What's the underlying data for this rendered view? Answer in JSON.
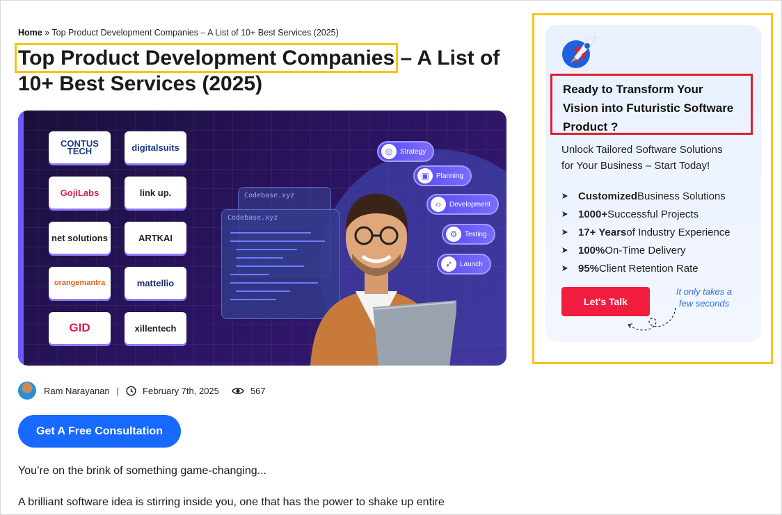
{
  "breadcrumb": {
    "home": "Home",
    "separator": "»",
    "current": "Top Product Development Companies – A List of 10+ Best Services (2025)"
  },
  "article": {
    "title_highlight": "Top Product Development Companies",
    "title_rest": " – A List of 10+ Best Services (2025)",
    "author": "Ram Narayanan",
    "date": "February 7th, 2025",
    "views": "567",
    "cta_label": "Get A Free Consultation",
    "paragraphs": [
      "You’re on the brink of something game-changing...",
      "A brilliant software idea is stirring inside you, one that has the power to shake up entire"
    ]
  },
  "hero": {
    "logos": [
      "CONTUS TECH",
      "digitalsuits",
      "GojiLabs",
      "link up.",
      "net solutions",
      "ARTKAI",
      "orangemantra",
      "mattellio",
      "GID",
      "xillentech"
    ],
    "code_windows": [
      "Codebase.xyz",
      "Codebase.xyz"
    ],
    "stages": [
      {
        "label": "Strategy",
        "icon": "target-icon"
      },
      {
        "label": "Planning",
        "icon": "presentation-icon"
      },
      {
        "label": "Development",
        "icon": "code-icon"
      },
      {
        "label": "Testing",
        "icon": "gear-icon"
      },
      {
        "label": "Launch",
        "icon": "rocket-icon"
      }
    ]
  },
  "sidebar": {
    "heading": "Ready to Transform Your Vision into Futuristic Software Product ?",
    "heading_lines": [
      "Ready to Transform Your",
      "Vision into Futuristic Software",
      "Product ?"
    ],
    "sub_lines": [
      "Unlock Tailored Software Solutions",
      "for Your Business – Start Today!"
    ],
    "items": [
      {
        "bold": "Customized",
        "rest": " Business Solutions"
      },
      {
        "bold": "1000+",
        "rest": " Successful Projects"
      },
      {
        "bold": "17+ Years",
        "rest": " of Industry Experience"
      },
      {
        "bold": "100%",
        "rest": " On-Time Delivery"
      },
      {
        "bold": "95%",
        "rest": " Client Retention Rate"
      }
    ],
    "button_label": "Let's Talk",
    "hint_lines": [
      "It only takes a",
      "few seconds"
    ]
  },
  "colors": {
    "accent_blue": "#1769ff",
    "accent_red": "#f11d3f",
    "highlight_yellow": "#f5c518",
    "outline_red": "#e0202a",
    "hero_purple": "#2a1460"
  }
}
